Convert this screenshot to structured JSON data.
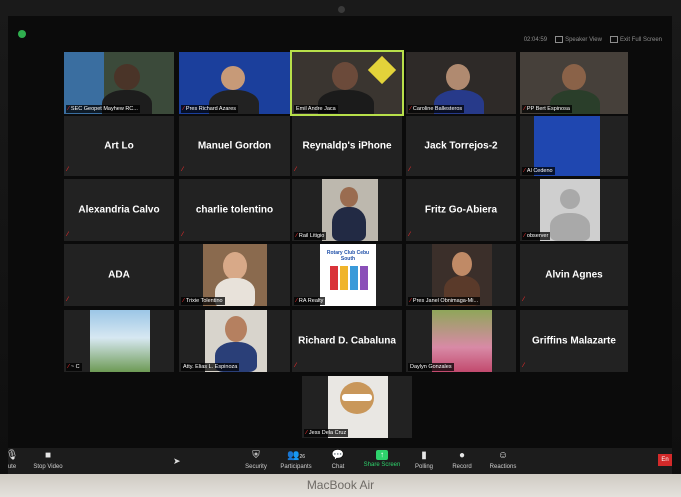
{
  "window": {
    "timer": "02:04:59",
    "speaker_view": "Speaker View",
    "exit_full_screen": "Exit Full Screen"
  },
  "participants": [
    {
      "name": "SEC Geopet Mayhew RC...",
      "muted": true,
      "video": true
    },
    {
      "name": "Pres Richard Azares",
      "muted": true,
      "video": true
    },
    {
      "name": "Emil Andre Jaca",
      "muted": false,
      "video": true,
      "active_speaker": true
    },
    {
      "name": "Caroline Ballesteros",
      "muted": true,
      "video": true
    },
    {
      "name": "PP Bert Espinosa",
      "muted": true,
      "video": true
    },
    {
      "name": "Art Lo",
      "muted": true,
      "video": false
    },
    {
      "name": "Manuel Gordon",
      "muted": true,
      "video": false
    },
    {
      "name": "Reynaldp's iPhone",
      "muted": true,
      "video": false
    },
    {
      "name": "Jack Torrejos-2",
      "muted": true,
      "video": false
    },
    {
      "name": "Al Cedeno",
      "muted": true,
      "video": true
    },
    {
      "name": "Alexandria Calvo",
      "muted": true,
      "video": false
    },
    {
      "name": "charlie tolentino",
      "muted": true,
      "video": false
    },
    {
      "name": "Rail Litigio",
      "muted": true,
      "video": true
    },
    {
      "name": "Fritz Go-Abiera",
      "muted": true,
      "video": false
    },
    {
      "name": "observer",
      "muted": true,
      "video": true
    },
    {
      "name": "ADA",
      "muted": true,
      "video": false
    },
    {
      "name": "Trixie Tolentino",
      "muted": true,
      "video": true
    },
    {
      "name": "RA Realty",
      "muted": true,
      "video": true,
      "logo_text": "Rotary Club Cebu South"
    },
    {
      "name": "Pres Janel Obnimaga-Mi...",
      "muted": true,
      "video": true
    },
    {
      "name": "Alvin Agnes",
      "muted": true,
      "video": false
    },
    {
      "name": "~ C",
      "muted": true,
      "video": true
    },
    {
      "name": "Atty. Elias L. Espinoza",
      "muted": true,
      "video": true
    },
    {
      "name": "Richard D. Cabaluna",
      "muted": true,
      "video": false
    },
    {
      "name": "Daylyn Gonzales",
      "muted": false,
      "video": true
    },
    {
      "name": "Griffins Malazarte",
      "muted": true,
      "video": false
    },
    {
      "name": "Jess Dela Cruz",
      "muted": true,
      "video": true
    }
  ],
  "toolbar": {
    "mute_partial": "ute",
    "stop_video": "Stop Video",
    "security": "Security",
    "participants": "Participants",
    "participants_count": "26",
    "chat": "Chat",
    "share_screen": "Share Screen",
    "polling": "Polling",
    "record": "Record",
    "reactions": "Reactions",
    "end_partial": "En"
  },
  "device": {
    "brand": "MacBook Air"
  },
  "colors": {
    "active_speaker": "#b8e04a",
    "muted": "#e02b2b",
    "share": "#2ed36c",
    "end": "#d32a2a"
  }
}
